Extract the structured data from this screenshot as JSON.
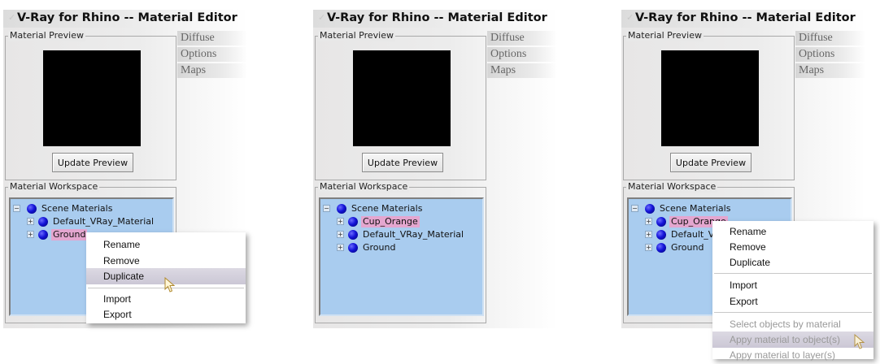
{
  "window_title": "V-Ray for Rhino -- Material Editor",
  "tabs": [
    "Diffuse",
    "Options",
    "Maps"
  ],
  "material_preview_label": "Material Preview",
  "update_preview_label": "Update Preview",
  "material_workspace_label": "Material Workspace",
  "panels": [
    {
      "tree": {
        "root": "Scene Materials",
        "items": [
          {
            "label": "Default_VRay_Material",
            "highlighted": false
          },
          {
            "label": "Ground",
            "highlighted": true
          }
        ]
      },
      "context_menu": {
        "items": [
          "Rename",
          "Remove",
          "Duplicate",
          "Import",
          "Export"
        ],
        "selected": "Duplicate"
      }
    },
    {
      "tree": {
        "root": "Scene Materials",
        "items": [
          {
            "label": "Cup_Orange",
            "highlighted": true
          },
          {
            "label": "Default_VRay_Material",
            "highlighted": false
          },
          {
            "label": "Ground",
            "highlighted": false
          }
        ]
      }
    },
    {
      "tree": {
        "root": "Scene Materials",
        "items": [
          {
            "label": "Cup_Orange",
            "highlighted": true
          },
          {
            "label": "Default_V",
            "highlighted": false
          },
          {
            "label": "Ground",
            "highlighted": false
          }
        ]
      },
      "context_menu": {
        "items": [
          "Rename",
          "Remove",
          "Duplicate",
          "Import",
          "Export",
          "Select objects by material",
          "Appy material to object(s)",
          "Appy material to layer(s)"
        ],
        "selected": "Appy material to object(s)"
      }
    }
  ],
  "colors": {
    "tree_background": "#a9ccef",
    "highlight": "#e4a6cf",
    "material_ball": "#1414d8",
    "menu_selected": "#cbc7d5"
  },
  "icons": [
    "vray-logo-icon",
    "material-ball-icon",
    "expand-plus-icon",
    "collapse-minus-icon",
    "mouse-cursor-icon"
  ]
}
